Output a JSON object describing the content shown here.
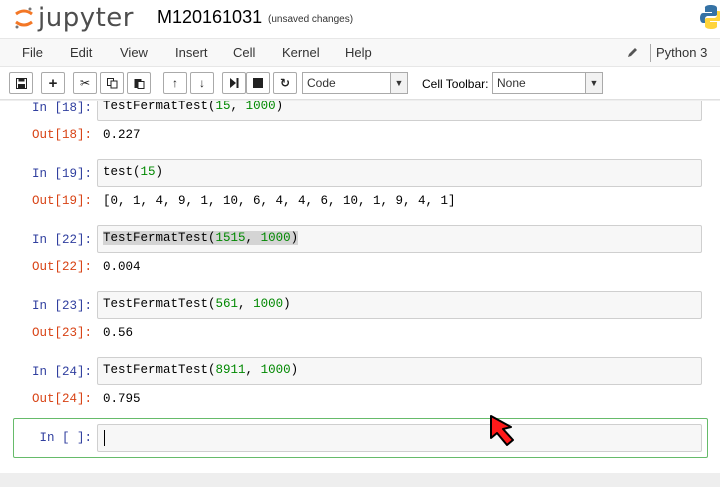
{
  "header": {
    "logo_text": "jupyter",
    "notebook_name": "M120161031",
    "status": "(unsaved changes)"
  },
  "menu": {
    "items": [
      "File",
      "Edit",
      "View",
      "Insert",
      "Cell",
      "Kernel",
      "Help"
    ],
    "kernel": "Python 3"
  },
  "toolbar": {
    "cell_type": "Code",
    "cell_toolbar_label": "Cell Toolbar:",
    "cell_toolbar_value": "None"
  },
  "cells": [
    {
      "in_prompt": "In [18]:",
      "code_fn": "TestFermatTest(",
      "arg1": "15",
      "sep": ", ",
      "arg2": "1000",
      "close": ")",
      "out_prompt": "Out[18]:",
      "output": "0.227"
    },
    {
      "in_prompt": "In [19]:",
      "code_fn": "test(",
      "arg1": "15",
      "sep": "",
      "arg2": "",
      "close": ")",
      "out_prompt": "Out[19]:",
      "output": "[0, 1, 4, 9, 1, 10, 6, 4, 4, 6, 10, 1, 9, 4, 1]"
    },
    {
      "in_prompt": "In [22]:",
      "code_fn": "TestFermatTest(",
      "arg1": "1515",
      "sep": ", ",
      "arg2": "1000",
      "close": ")",
      "out_prompt": "Out[22]:",
      "output": "0.004"
    },
    {
      "in_prompt": "In [23]:",
      "code_fn": "TestFermatTest(",
      "arg1": "561",
      "sep": ", ",
      "arg2": "1000",
      "close": ")",
      "out_prompt": "Out[23]:",
      "output": "0.56"
    },
    {
      "in_prompt": "In [24]:",
      "code_fn": "TestFermatTest(",
      "arg1": "8911",
      "sep": ", ",
      "arg2": "1000",
      "close": ")",
      "out_prompt": "Out[24]:",
      "output": "0.795"
    }
  ],
  "active_cell": {
    "in_prompt": "In [ ]:",
    "code": ""
  },
  "colors": {
    "in_prompt": "#303f9f",
    "out_prompt": "#d84315",
    "number": "#008800",
    "selected_border": "#66bb6a",
    "pointer": "#ff0000"
  }
}
